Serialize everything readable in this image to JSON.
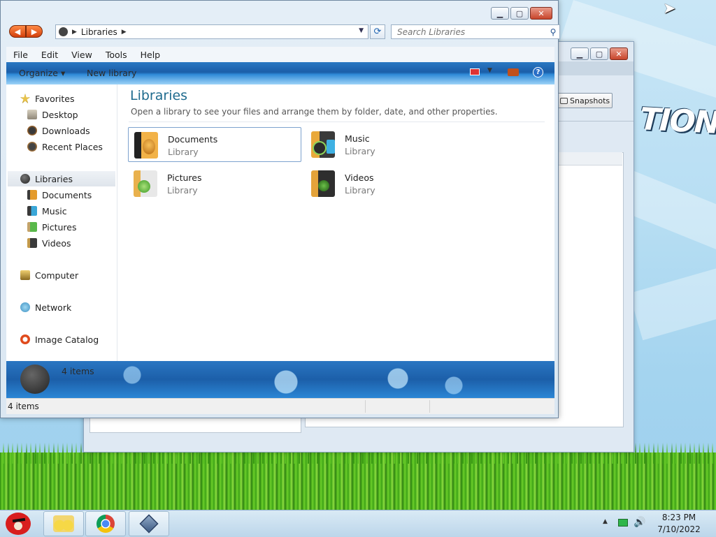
{
  "explorer": {
    "address": {
      "path_label": "Libraries"
    },
    "search": {
      "placeholder": "Search Libraries"
    },
    "menu": [
      "File",
      "Edit",
      "View",
      "Tools",
      "Help"
    ],
    "commands": {
      "organize": "Organize ▾",
      "new_library": "New library"
    },
    "sidebar": {
      "favorites": {
        "label": "Favorites",
        "items": [
          "Desktop",
          "Downloads",
          "Recent Places"
        ]
      },
      "libraries": {
        "label": "Libraries",
        "items": [
          "Documents",
          "Music",
          "Pictures",
          "Videos"
        ]
      },
      "computer": "Computer",
      "network": "Network",
      "image_catalog": "Image Catalog"
    },
    "content": {
      "title": "Libraries",
      "subtitle": "Open a library to see your files and arrange them by folder, date, and other properties.",
      "libraries": [
        {
          "name": "Documents",
          "kind": "Library"
        },
        {
          "name": "Music",
          "kind": "Library"
        },
        {
          "name": "Pictures",
          "kind": "Library"
        },
        {
          "name": "Videos",
          "kind": "Library"
        }
      ]
    },
    "details": {
      "count": "4 items"
    },
    "status": {
      "count": "4 items"
    }
  },
  "back_window": {
    "snapshots_label": "Snapshots"
  },
  "desktop": {
    "logo_fragment": "TION"
  },
  "taskbar": {
    "time": "8:23 PM",
    "date": "7/10/2022"
  },
  "colors": {
    "accent": "#1c5fa9",
    "title_text": "#1f6b8e",
    "close": "#c8452c"
  }
}
